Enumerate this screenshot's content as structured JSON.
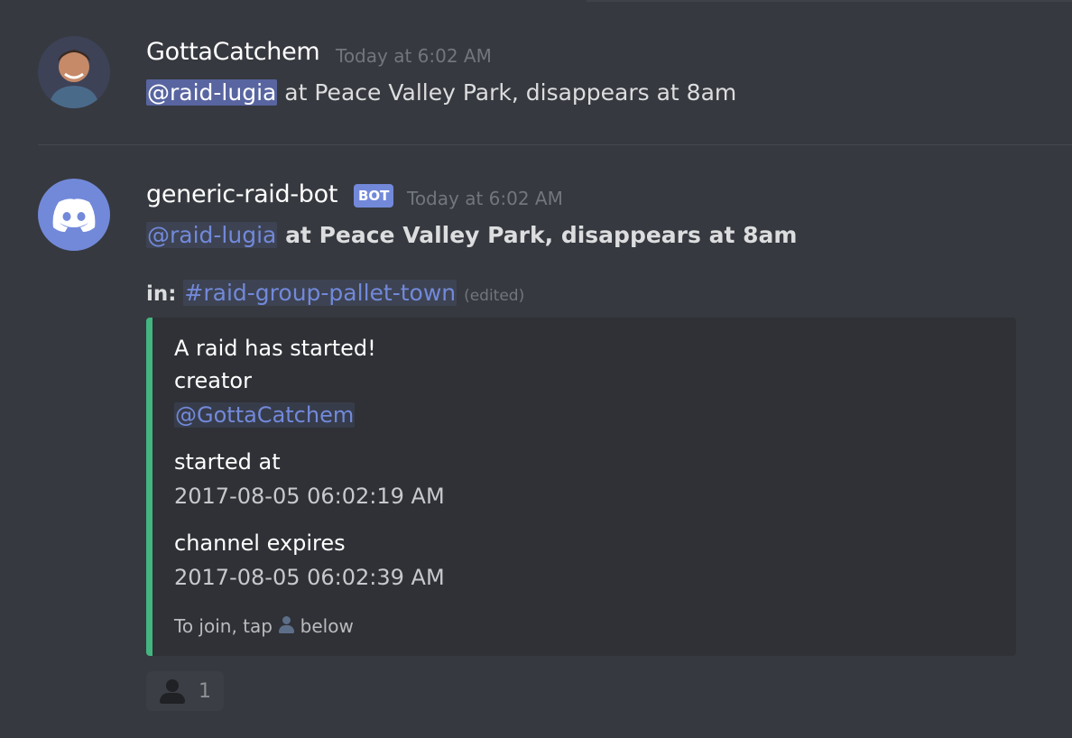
{
  "message1": {
    "username": "GottaCatchem",
    "timestamp": "Today at 6:02 AM",
    "mention": "@raid-lugia",
    "text": " at Peace Valley Park, disappears at 8am"
  },
  "message2": {
    "username": "generic-raid-bot",
    "bot_tag": "BOT",
    "timestamp": "Today at 6:02 AM",
    "mention": "@raid-lugia",
    "text": " at Peace Valley Park, disappears at 8am",
    "in_label": "in:",
    "channel": "#raid-group-pallet-town",
    "edited": "(edited)",
    "embed": {
      "accent_color": "#43b581",
      "title": "A raid has started!",
      "fields": [
        {
          "name": "creator",
          "value": "@GottaCatchem"
        },
        {
          "name": "started at",
          "value": "2017-08-05 06:02:19 AM"
        },
        {
          "name": "channel expires",
          "value": "2017-08-05 06:02:39 AM"
        }
      ],
      "footer_before": "To join, tap ",
      "footer_icon": "person-icon",
      "footer_after": " below"
    },
    "reaction": {
      "icon": "bust-in-silhouette-icon",
      "count": "1"
    }
  }
}
